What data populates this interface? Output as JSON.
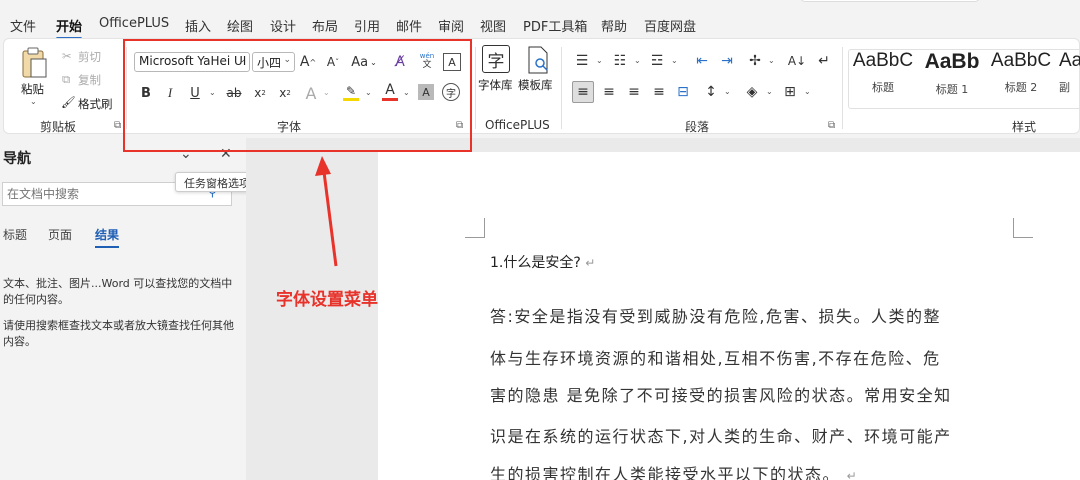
{
  "menu": {
    "tabs": [
      "文件",
      "开始",
      "OfficePLUS",
      "插入",
      "绘图",
      "设计",
      "布局",
      "引用",
      "邮件",
      "审阅",
      "视图",
      "PDF工具箱",
      "帮助",
      "百度网盘"
    ],
    "active_tab": "开始"
  },
  "ribbon": {
    "clipboard": {
      "paste": "粘贴",
      "cut": "剪切",
      "copy": "复制",
      "format_painter": "格式刷",
      "group_label": "剪贴板"
    },
    "font": {
      "font_name": "Microsoft YaHei UI",
      "font_size": "小四",
      "change_case": "Aa",
      "phonetic_top": "wén",
      "phonetic_bottom": "文",
      "group_label": "字体",
      "font_color": "#e8332b",
      "highlight_color": "#f5d800"
    },
    "officeplus": {
      "font_library": "字体库",
      "template_library": "模板库",
      "group_label": "OfficePLUS"
    },
    "paragraph": {
      "group_label": "段落"
    },
    "styles": {
      "items": [
        {
          "sample": "AaBbC",
          "name": "标题"
        },
        {
          "sample": "AaBb",
          "name": "标题 1"
        },
        {
          "sample": "AaBbC",
          "name": "标题 2"
        },
        {
          "sample": "Aa",
          "name": "副"
        }
      ],
      "group_label": "样式"
    }
  },
  "annotation": {
    "label": "字体设置菜单",
    "color": "#e8332b"
  },
  "nav": {
    "title": "导航",
    "search_placeholder": "在文档中搜索",
    "tooltip": "任务窗格选项",
    "tabs": [
      "标题",
      "页面",
      "结果"
    ],
    "active_tab": "结果",
    "message_1": "文本、批注、图片...Word 可以查找您的文档中的任何内容。",
    "message_2": "请使用搜索框查找文本或者放大镜查找任何其他内容。"
  },
  "document": {
    "heading": "1.什么是安全?",
    "lines": [
      "答:安全是指没有受到威胁没有危险,危害、损失。人类的整",
      "体与生存环境资源的和谐相处,互相不伤害,不存在危险、危",
      "害的隐患 是免除了不可接受的损害风险的状态。常用安全知",
      "识是在系统的运行状态下,对人类的生命、财产、环境可能产",
      "生的损害控制在人类能接受水平以下的状态。"
    ]
  }
}
